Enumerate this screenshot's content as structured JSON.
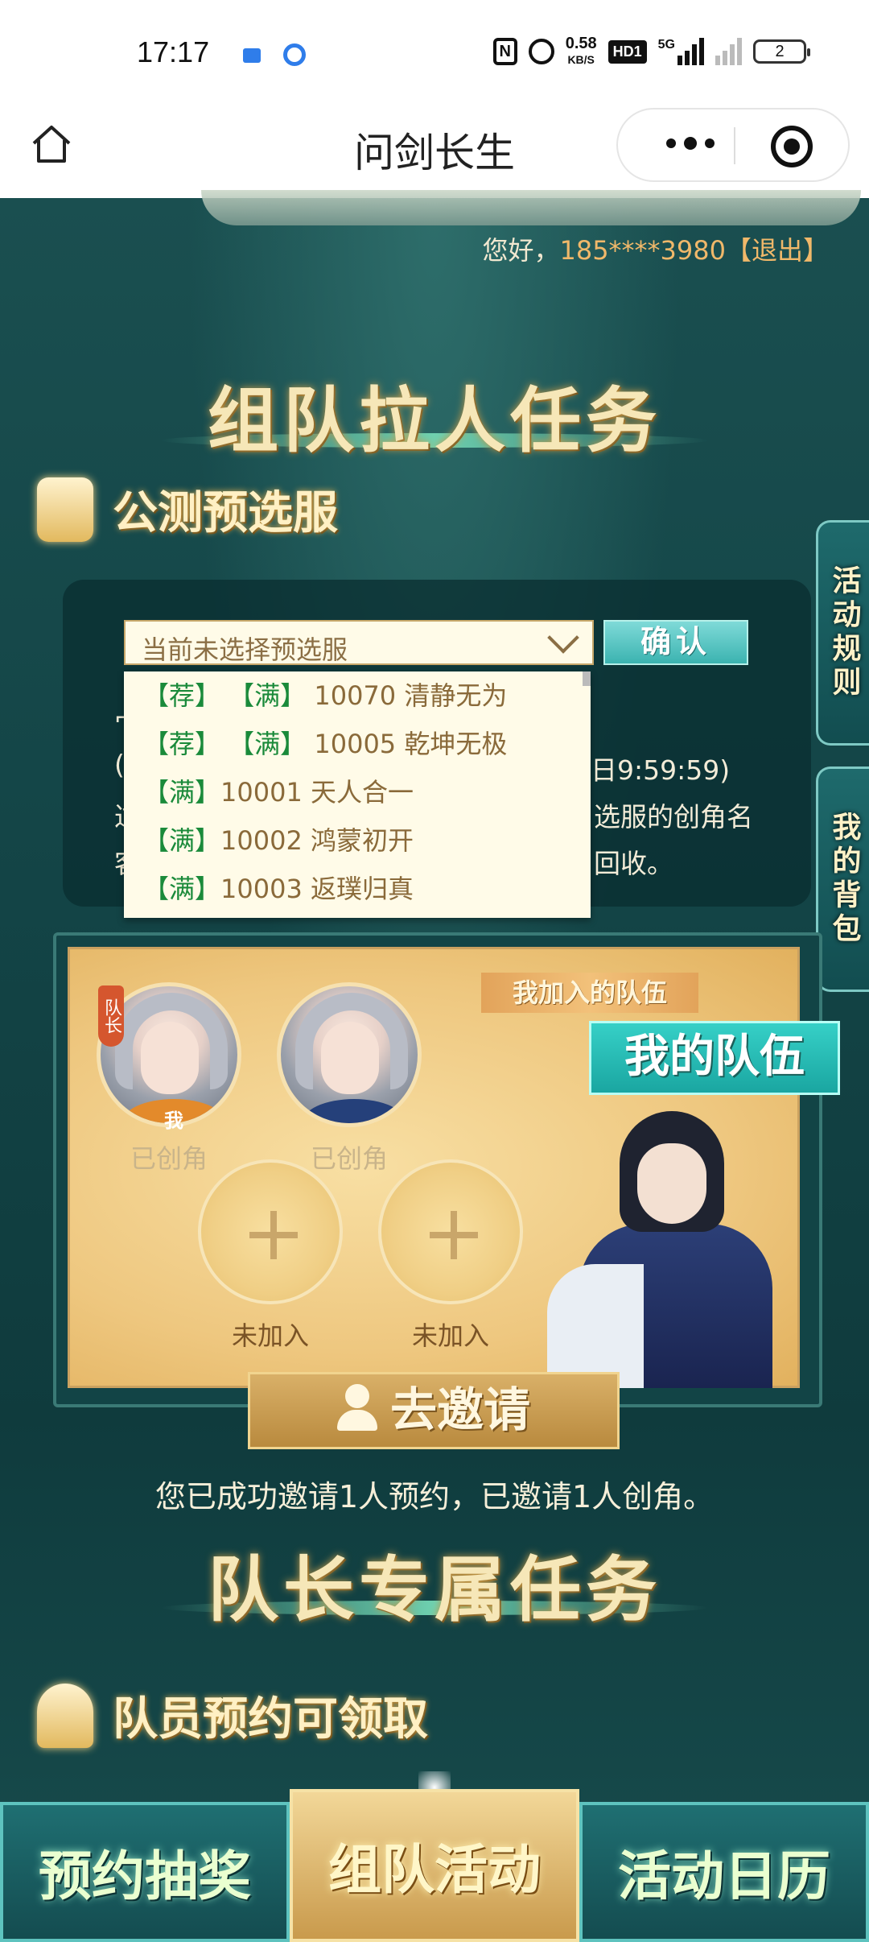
{
  "status_bar": {
    "time": "17:17",
    "net_speed": "0.58",
    "net_unit": "KB/S",
    "hd_label": "HD1",
    "signal_5g": "5G",
    "battery": "2"
  },
  "title_bar": {
    "title": "问剑长生",
    "icons": [
      "home-icon",
      "more-icon",
      "target-icon"
    ]
  },
  "greeting": {
    "prefix": "您好，",
    "phone": "185****3980",
    "logout": "【退出】"
  },
  "section1": {
    "title": "组队拉人任务",
    "subtitle": "公测预选服"
  },
  "server_select": {
    "value": "当前未选择预选服",
    "confirm": "确认",
    "options": [
      {
        "tags": "【荐】 【满】",
        "name": "10070 清静无为"
      },
      {
        "tags": "【荐】 【满】",
        "name": "10005 乾坤无极"
      },
      {
        "tags": "【满】",
        "name": "10001 天人合一"
      },
      {
        "tags": "【满】",
        "name": "10002 鸿蒙初开"
      },
      {
        "tags": "【满】",
        "name": "10003 返璞归真"
      }
    ],
    "partial_lines": [
      "宀",
      "(",
      "日9:59:59)",
      "选服的创角名",
      "回收。",
      "过",
      "客"
    ]
  },
  "side_tabs": {
    "rules": "活动规则",
    "bag": "我的背包"
  },
  "team": {
    "join_ribbon": "我加入的队伍",
    "my_team": "我的队伍",
    "leader_tag": "队长",
    "me_tag": "我",
    "members": [
      {
        "status": "已创角"
      },
      {
        "status": "已创角"
      }
    ],
    "empty_slots": [
      {
        "status": "未加入"
      },
      {
        "status": "未加入"
      }
    ],
    "invite_button": "去邀请",
    "invite_status": "您已成功邀请1人预约，已邀请1人创角。"
  },
  "section2": {
    "title": "队长专属任务",
    "subtitle": "队员预约可领取"
  },
  "bottom_tabs": [
    {
      "label": "预约抽奖",
      "active": false
    },
    {
      "label": "组队活动",
      "active": true
    },
    {
      "label": "活动日历",
      "active": false
    }
  ],
  "colors": {
    "accent_gold": "#f0b86a",
    "teal": "#1aa6a1",
    "tag_green": "#1a8a3a"
  }
}
